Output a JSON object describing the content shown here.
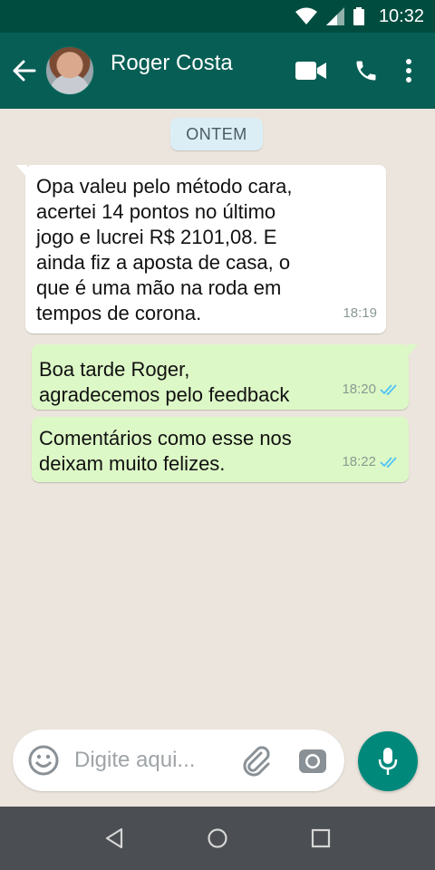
{
  "status_bar": {
    "time": "10:32"
  },
  "header": {
    "contact_name": "Roger Costa"
  },
  "chat": {
    "date_label": "ONTEM",
    "messages": [
      {
        "direction": "incoming",
        "text": "Opa valeu pelo método cara,\nacertei 14 pontos no último\njogo e lucrei R$ 2101,08. E\nainda fiz a aposta de casa, o\nque é uma mão na roda em\ntempos de corona.",
        "time": "18:19"
      },
      {
        "direction": "outgoing",
        "text": "Boa tarde Roger,\nagradecemos pelo feedback",
        "time": "18:20",
        "status": "read"
      },
      {
        "direction": "outgoing",
        "text": "Comentários como esse nos\ndeixam muito felizes.",
        "time": "18:22",
        "status": "read"
      }
    ]
  },
  "composer": {
    "placeholder": "Digite aqui..."
  },
  "colors": {
    "header": "#075e54",
    "status_bar": "#004d40",
    "outgoing_bubble": "#dcf8c6",
    "read_ticks": "#4fc3f7",
    "mic_button": "#00897b"
  }
}
